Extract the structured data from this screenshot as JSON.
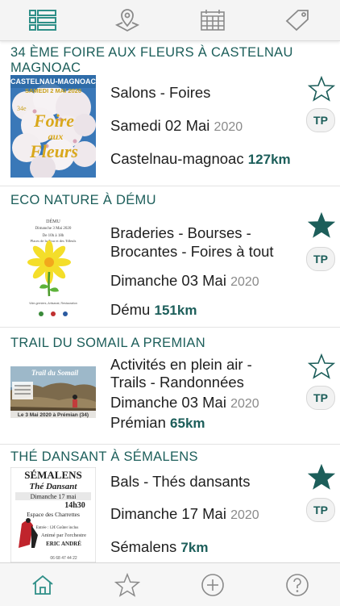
{
  "app": {
    "accent": "#1c5e5a",
    "icon_color": "#7fb7b3"
  },
  "top_tabs": [
    {
      "name": "list-view-icon",
      "active": true
    },
    {
      "name": "map-pin-icon",
      "active": false
    },
    {
      "name": "calendar-icon",
      "active": false
    },
    {
      "name": "tag-icon",
      "active": false
    }
  ],
  "events": [
    {
      "title": "34 ème FOIRE AUX FLEURS À CASTELNAU MAGNOAC",
      "poster": {
        "top_text": "CASTELNAU-MAGNOAC",
        "date_text": "SAMEDI 2 MAI 2020",
        "big1": "Foire",
        "big2": "aux",
        "big3": "Fleurs",
        "edition": "34e"
      },
      "category": "Salons - Foires",
      "category_line2": "",
      "date": "Samedi 02 Mai",
      "year": "2020",
      "place": "Castelnau-magnoac",
      "distance": "127km",
      "favorite": false,
      "badge": "TP"
    },
    {
      "title": "ECO NATURE À DÉMU",
      "poster": {
        "line1": "DÉMU",
        "line2": "Dimanche 3 Mai 2020",
        "line3": "De 10h à 18h",
        "line4": "Places de la Tour et des Tilleuls",
        "footer": "Vide-greniers, Artisanat, Restauration"
      },
      "category": "Braderies - Bourses -",
      "category_line2": "Brocantes - Foires à tout",
      "date": "Dimanche 03 Mai",
      "year": "2020",
      "place": "Dému",
      "distance": "151km",
      "favorite": true,
      "badge": "TP"
    },
    {
      "title": "TRAIL DU SOMAIL A PREMIAN",
      "poster": {
        "top_text": "Trail du Somail",
        "bottom_text": "Le 3 Mai 2020 à Prémian (34)"
      },
      "category": "Activités en plein air -",
      "category_line2": "Trails - Randonnées",
      "date": "Dimanche 03 Mai",
      "year": "2020",
      "place": "Prémian",
      "distance": "65km",
      "favorite": false,
      "badge": "TP"
    },
    {
      "title": "THÉ DANSANT À SÉMALENS",
      "poster": {
        "line1": "SÉMALENS",
        "line2": "Thé Dansant",
        "line3": "Dimanche 17 mai",
        "line4": "14h30",
        "line5": "Espace des Charrettes",
        "line6": "Animé par l'orchestre",
        "line7": "ERIC ANDRÉ",
        "price": "Entrée : 12€ Goûter inclus",
        "phone": "06 68 47 44 22"
      },
      "category": "Bals - Thés dansants",
      "category_line2": "",
      "date": "Dimanche 17 Mai",
      "year": "2020",
      "place": "Sémalens",
      "distance": "7km",
      "favorite": true,
      "badge": "TP"
    }
  ],
  "bottom_tabs": [
    {
      "name": "home-icon",
      "active": true
    },
    {
      "name": "star-icon",
      "active": false
    },
    {
      "name": "add-icon",
      "active": false
    },
    {
      "name": "help-icon",
      "active": false
    }
  ]
}
